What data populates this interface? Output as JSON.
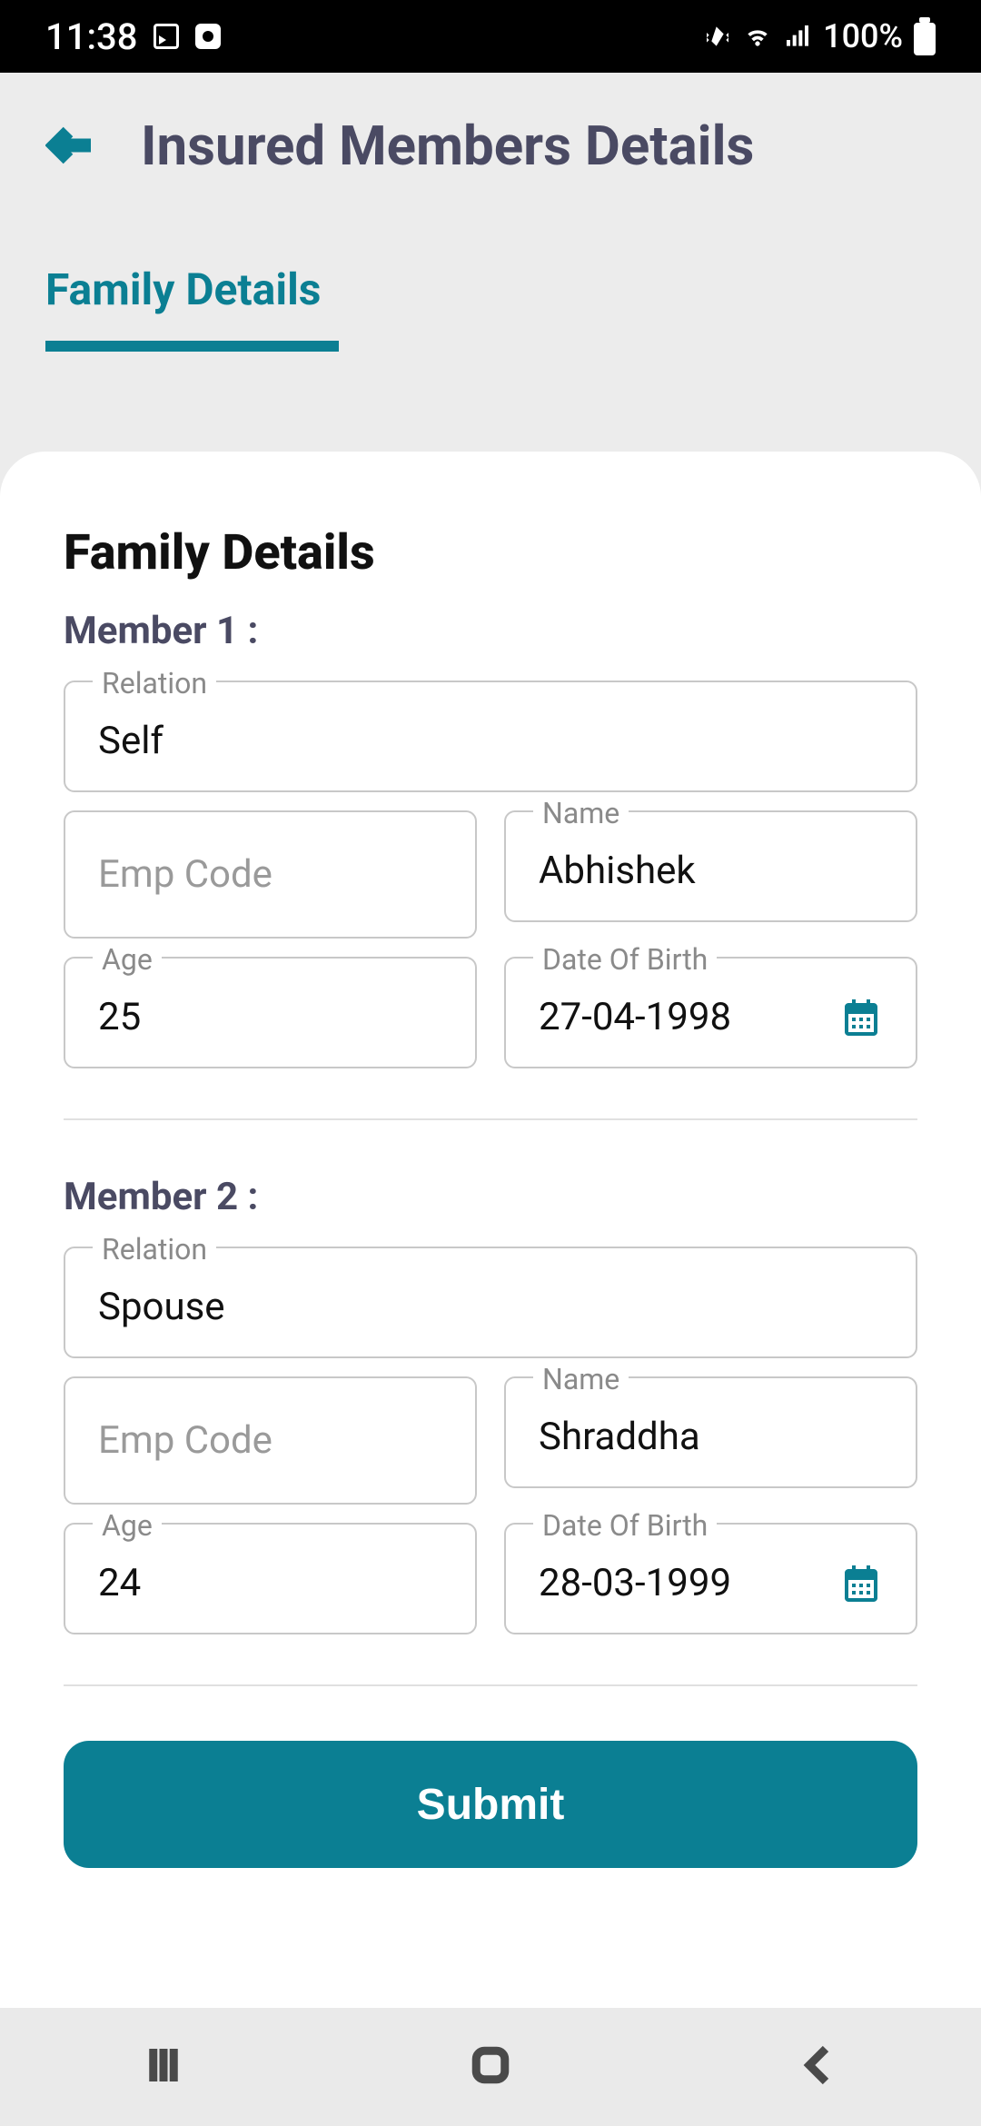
{
  "status": {
    "time": "11:38",
    "battery_text": "100%"
  },
  "header": {
    "title": "Insured Members Details"
  },
  "tabs": {
    "family_details": "Family Details"
  },
  "card": {
    "title": "Family Details",
    "labels": {
      "relation": "Relation",
      "emp_code_placeholder": "Emp Code",
      "name": "Name",
      "age": "Age",
      "dob": "Date Of Birth"
    },
    "members": [
      {
        "heading": "Member 1 :",
        "relation": "Self",
        "emp_code": "",
        "name": "Abhishek",
        "age": "25",
        "dob": "27-04-1998"
      },
      {
        "heading": "Member 2 :",
        "relation": "Spouse",
        "emp_code": "",
        "name": "Shraddha",
        "age": "24",
        "dob": "28-03-1999"
      }
    ],
    "submit_label": "Submit"
  }
}
